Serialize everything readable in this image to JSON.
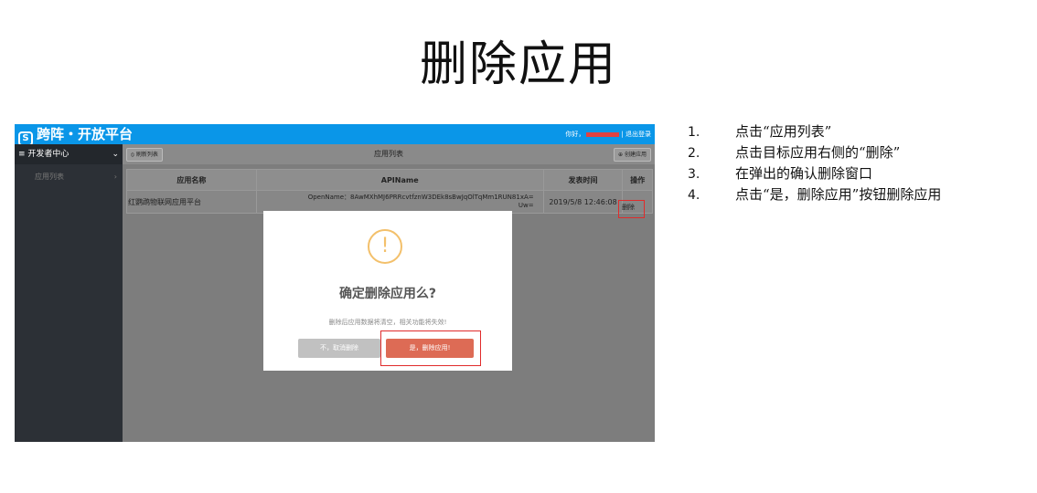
{
  "slide": {
    "title": "删除应用"
  },
  "app": {
    "brand": "跨阵・开放平台",
    "logo_icon": "brand-logo-icon",
    "greeting": "你好，",
    "logout": "| 退出登录",
    "sidebar": {
      "header": "≡ 开发者中心",
      "items": [
        {
          "label": "应用列表"
        }
      ]
    },
    "toolbar": {
      "refresh_label": "刷新列表",
      "list_title": "应用列表",
      "create_label": "创建应用"
    },
    "table": {
      "headers": [
        "应用名称",
        "APIName",
        "发表时间",
        "操作"
      ],
      "rows": [
        {
          "name": "红鹦鹉物联网应用平台",
          "api_line1": "OpenName：8AwMXhMJ6PRRcvtfznW3DEk8sBwJqOlTqMm1RUN81xA=",
          "api_line2": "Uw=",
          "time": "2019/5/8 12:46:08",
          "action": "删除"
        }
      ]
    },
    "modal": {
      "icon": "!",
      "title": "确定删除应用么?",
      "message": "删除后应用数据将清空，相关功能将失效!",
      "cancel_label": "不，取消删除",
      "confirm_label": "是，删除应用!"
    },
    "colors": {
      "topbar": "#0a96e8",
      "sidebar": "#2c3036",
      "confirm": "#dd6b55",
      "cancel": "#c1c1c1",
      "highlight": "#e02b2b",
      "warning": "#f3c06b"
    }
  },
  "steps": [
    {
      "num": "1.",
      "text": "点击“应用列表”"
    },
    {
      "num": "2.",
      "text": "点击目标应用右侧的“删除”"
    },
    {
      "num": "3.",
      "text": "在弹出的确认删除窗口"
    },
    {
      "num": "4.",
      "text": "点击“是，删除应用”按钮删除应用"
    }
  ]
}
